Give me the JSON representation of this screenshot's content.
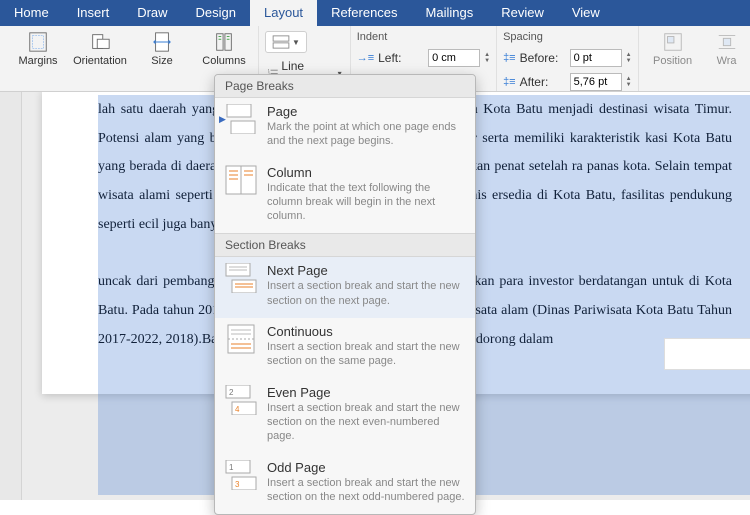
{
  "tabs": [
    "Home",
    "Insert",
    "Draw",
    "Design",
    "Layout",
    "References",
    "Mailings",
    "Review",
    "View"
  ],
  "activeTab": "Layout",
  "ribbon": {
    "margins": "Margins",
    "orientation": "Orientation",
    "size": "Size",
    "columns": "Columns",
    "lineNumbers": "Line Numbers",
    "indent": {
      "label": "Indent",
      "leftLabel": "Left:",
      "leftVal": "0 cm"
    },
    "spacing": {
      "label": "Spacing",
      "beforeLabel": "Before:",
      "beforeVal": "0 pt",
      "afterLabel": "After:",
      "afterVal": "5,76 pt"
    },
    "position": "Position",
    "wrap": "Wra"
  },
  "dropdown": {
    "section1": "Page Breaks",
    "section2": "Section Breaks",
    "items": [
      {
        "title": "Page",
        "desc": "Mark the point at which one page ends and the next page begins."
      },
      {
        "title": "Column",
        "desc": "Indicate that the text following the column break will begin in the next column."
      },
      {
        "title": "Next Page",
        "desc": "Insert a section break and start the new section on the next page."
      },
      {
        "title": "Continuous",
        "desc": "Insert a section break and start the new section on the same page."
      },
      {
        "title": "Even Page",
        "desc": "Insert a section break and start the new section on the next even-numbered page."
      },
      {
        "title": "Odd Page",
        "desc": "Insert a section break and start the new section on the next odd-numbered page."
      }
    ]
  },
  "document": {
    "text": "lah satu daerah yang memiliki potensi pariwisata idak heran jika Kota Batu menjadi destinasi wisata Timur. Potensi alam yang begitu menarik di Kota i wisata yang tersebar serta memiliki karakteristik kasi Kota Batu yang berada di daerah ketinggian ri, pengunjung bisa menghilangkan penat setelah ra panas kota. Selain tempat wisata alami seperti ata yang memanfaatkan keindahan alam. Jenis ersedia di Kota Batu, fasilitas pendukung seperti ecil juga banyak di kota ini.\n\nuncak dari pembangunan pariwisata di Kota Batu, at memungkinkan para investor berdatangan untuk di Kota Batu. Pada tahun 2018 ada sekitar 55 pariwisata buatan dan pariwisata alam (Dinas Pariwisata Kota Batu Tahun 2017-2022, 2018).Banyaknya tempat wisata di Kota Batu juga mendorong dalam"
  }
}
